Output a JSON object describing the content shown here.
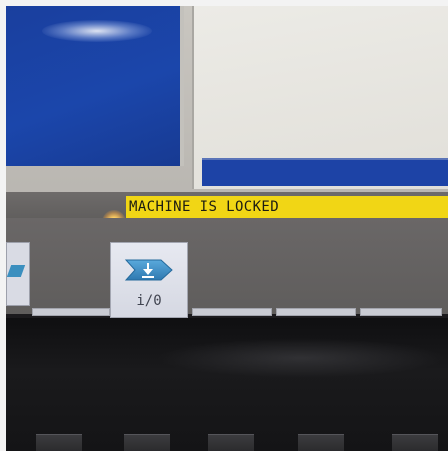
{
  "status": {
    "message": "MACHINE IS LOCKED",
    "color": "#f1d615"
  },
  "softkeys": {
    "io": {
      "label": "i/0",
      "icon": "download-arrow-icon"
    },
    "left_partial": {
      "icon": "arrow-right-icon"
    }
  },
  "colors": {
    "panel_blue": "#1b46ab",
    "status_yellow": "#f1d615",
    "softkey_bg": "#e0e3ec"
  }
}
